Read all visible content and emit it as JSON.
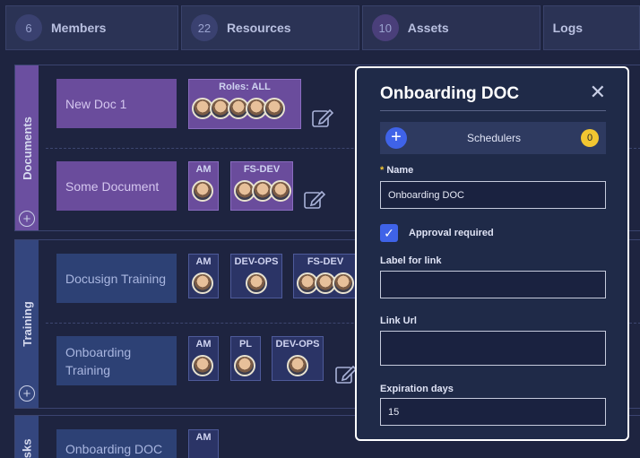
{
  "tabs": [
    {
      "count": "6",
      "label": "Members"
    },
    {
      "count": "22",
      "label": "Resources"
    },
    {
      "count": "10",
      "label": "Assets"
    },
    {
      "label": "Logs"
    }
  ],
  "sections": {
    "documents": {
      "title": "Documents"
    },
    "training": {
      "title": "Training"
    },
    "tasks": {
      "title": "Tasks"
    }
  },
  "rows": {
    "new_doc": {
      "title": "New Doc 1",
      "badges": [
        {
          "title": "Roles: ALL"
        }
      ]
    },
    "some_doc": {
      "title": "Some Document",
      "badges": [
        {
          "title": "AM"
        },
        {
          "title": "FS-DEV"
        }
      ]
    },
    "docusign": {
      "title": "Docusign Training",
      "badges": [
        {
          "title": "AM"
        },
        {
          "title": "DEV-OPS"
        },
        {
          "title": "FS-DEV"
        }
      ]
    },
    "onboarding_training": {
      "title": "Onboarding Training",
      "badges": [
        {
          "title": "AM"
        },
        {
          "title": "PL"
        },
        {
          "title": "DEV-OPS"
        }
      ]
    },
    "onboarding_doc": {
      "title": "Onboarding DOC",
      "badges": [
        {
          "title": "AM"
        }
      ]
    }
  },
  "modal": {
    "title": "Onboarding DOC",
    "close": "✕",
    "schedulers": {
      "label": "Schedulers",
      "count": "0"
    },
    "name_label": "Name",
    "name_required": "*",
    "name_value": "Onboarding DOC",
    "approval_label": "Approval required",
    "approval_checked": true,
    "link_label_label": "Label for link",
    "link_label_value": "",
    "link_url_label": "Link Url",
    "link_url_value": "",
    "expiration_label": "Expiration days",
    "expiration_value": "15"
  },
  "icons": {
    "add": "plus-circle-icon",
    "edit": "edit-icon",
    "check": "check-icon"
  }
}
